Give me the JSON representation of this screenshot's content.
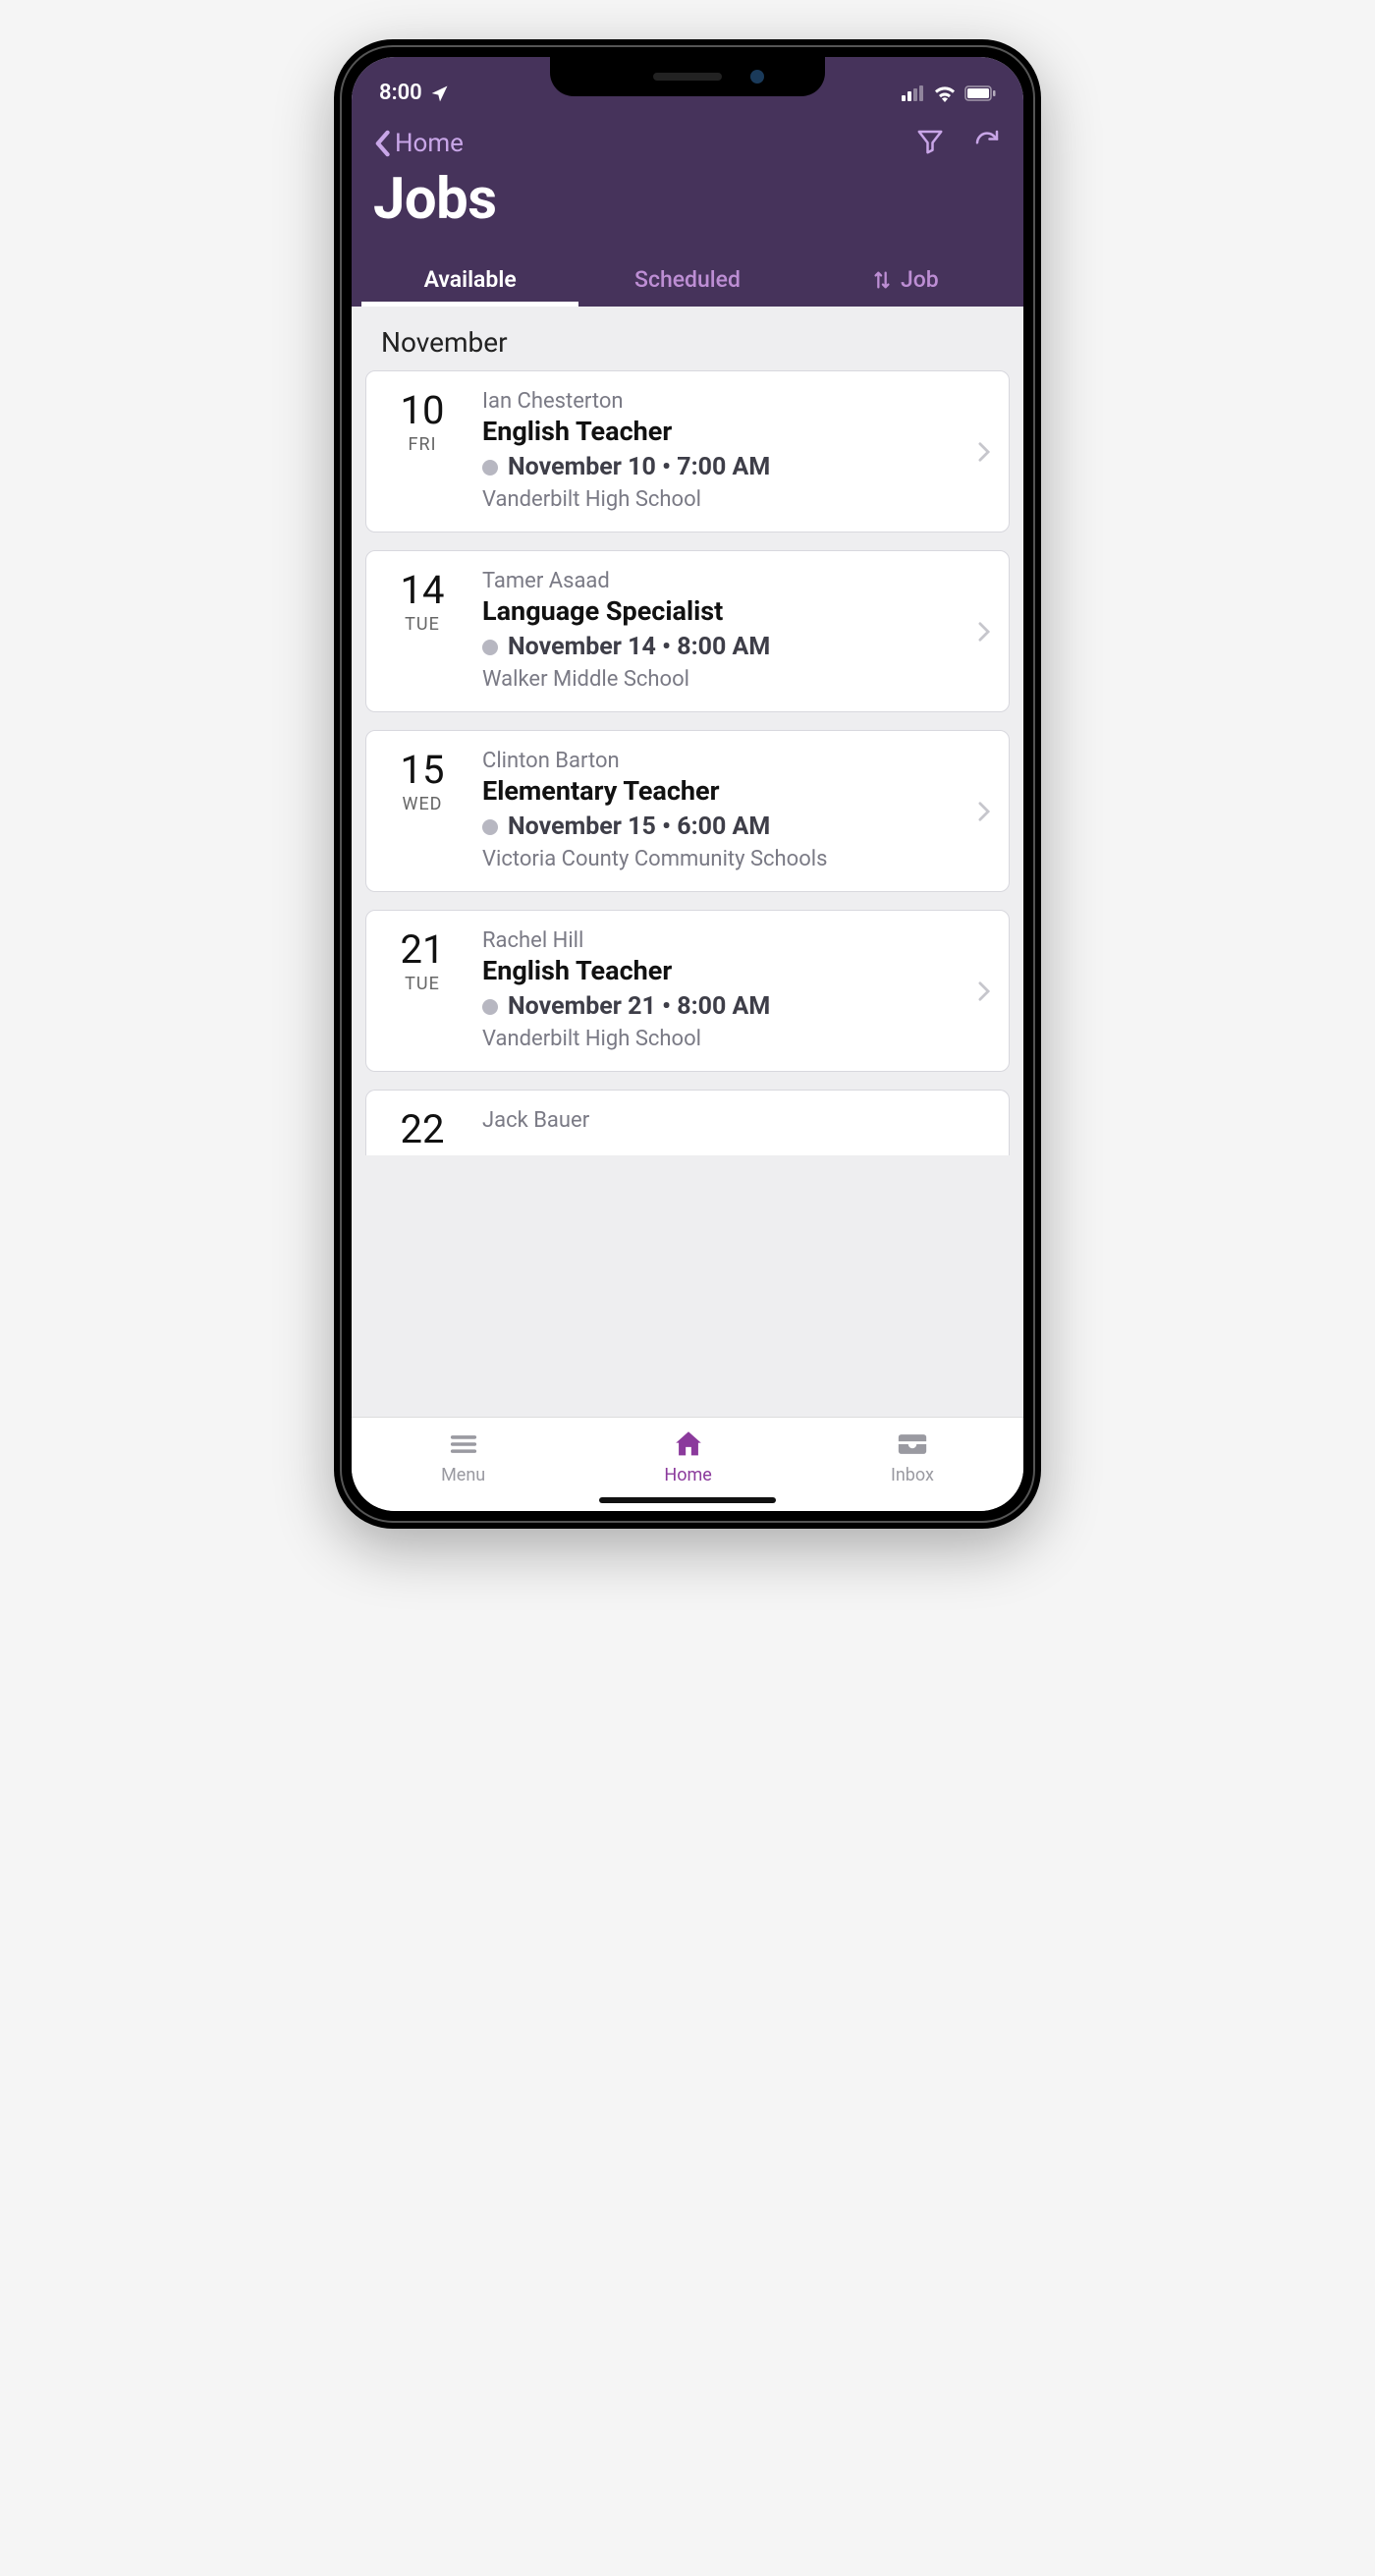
{
  "status": {
    "time": "8:00"
  },
  "nav": {
    "back_label": "Home",
    "title": "Jobs"
  },
  "tabs": {
    "available": "Available",
    "scheduled": "Scheduled",
    "job": "Job"
  },
  "month_header": "November",
  "jobs": [
    {
      "daynum": "10",
      "dayname": "FRI",
      "person": "Ian Chesterton",
      "role": "English Teacher",
      "when": "November 10 • 7:00 AM",
      "location": "Vanderbilt High School"
    },
    {
      "daynum": "14",
      "dayname": "TUE",
      "person": "Tamer Asaad",
      "role": "Language Specialist",
      "when": "November 14 • 8:00 AM",
      "location": "Walker Middle School"
    },
    {
      "daynum": "15",
      "dayname": "WED",
      "person": "Clinton Barton",
      "role": "Elementary Teacher",
      "when": "November 15 • 6:00 AM",
      "location": "Victoria County Community Schools"
    },
    {
      "daynum": "21",
      "dayname": "TUE",
      "person": "Rachel Hill",
      "role": "English Teacher",
      "when": "November 21 • 8:00 AM",
      "location": "Vanderbilt High School"
    },
    {
      "daynum": "22",
      "dayname": "",
      "person": "Jack Bauer",
      "role": "",
      "when": "",
      "location": ""
    }
  ],
  "bottomnav": {
    "menu": "Menu",
    "home": "Home",
    "inbox": "Inbox"
  }
}
